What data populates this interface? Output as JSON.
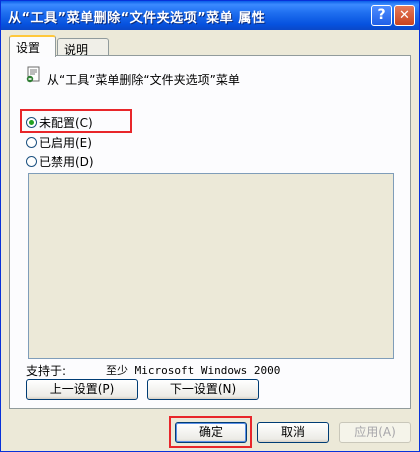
{
  "window": {
    "title": "从“工具”菜单删除“文件夹选项”菜单 属性",
    "help_label": "?",
    "close_label": "✕"
  },
  "tabs": [
    {
      "label": "设置",
      "active": true
    },
    {
      "label": "说明",
      "active": false
    }
  ],
  "policy": {
    "icon": "policy-icon",
    "title": "从“工具”菜单删除“文件夹选项”菜单"
  },
  "options": [
    {
      "label": "未配置(C)",
      "checked": true
    },
    {
      "label": "已启用(E)",
      "checked": false
    },
    {
      "label": "已禁用(D)",
      "checked": false
    }
  ],
  "support": {
    "label": "支持于:",
    "value": "至少 Microsoft Windows 2000"
  },
  "nav": {
    "prev_label": "上一设置(P)",
    "next_label": "下一设置(N)"
  },
  "dialog_buttons": {
    "ok_label": "确定",
    "cancel_label": "取消",
    "apply_label": "应用(A)"
  },
  "colors": {
    "highlight": "#e8262a",
    "title_bar": "#0a5ee8",
    "window_bg": "#ece9d8"
  }
}
